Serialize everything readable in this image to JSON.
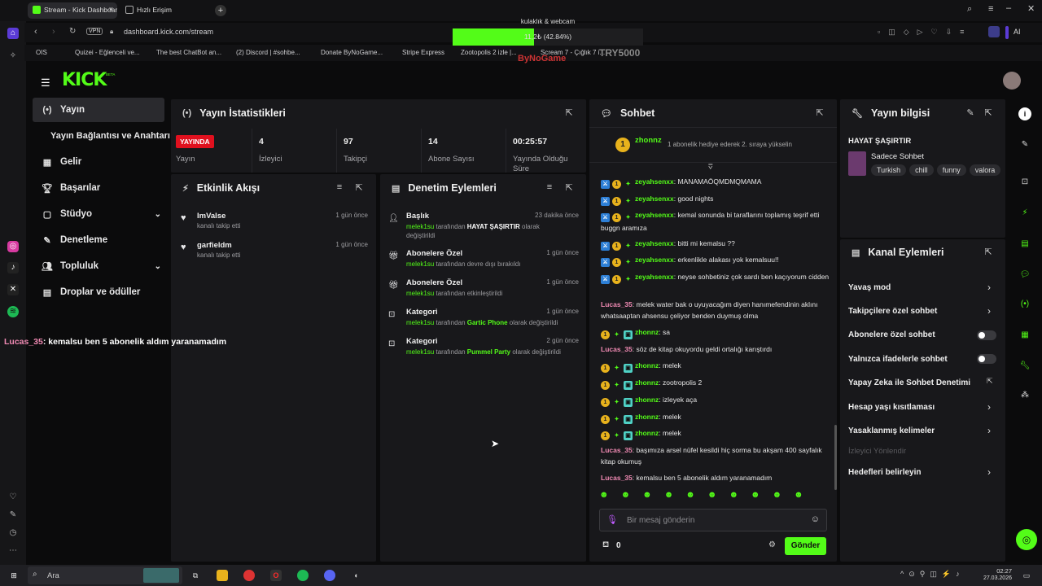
{
  "browser": {
    "tabs": [
      {
        "label": "Stream - Kick Dashboard"
      },
      {
        "label": "Hızlı Erişim"
      }
    ],
    "url": "dashboard.kick.com/stream",
    "vpn": "VPN",
    "ai_label": "AI",
    "bookmarks": [
      "OIS",
      "Quizei - Eğlenceli ve...",
      "The best ChatBot an...",
      "(2) Discord | #sohbe...",
      "Donate ByNoGame...",
      "Stripe Express",
      "Zootopolis 2 izle |...",
      "Scream 7 - Çığlık 7 i..."
    ]
  },
  "overlay": {
    "goal_label": "kulaklık & webcam",
    "goal_text": "11,2₺ (42.84%)",
    "goal_progress": 0.4284,
    "donate_code": "TRY5000",
    "brand": "ByNoGame"
  },
  "kick": {
    "logo": "KICK",
    "logo_beta": "BETA"
  },
  "sidebar": {
    "items": [
      {
        "label": "Yayın"
      },
      {
        "label": "Yayın Bağlantısı ve Anahtarı"
      },
      {
        "label": "Gelir"
      },
      {
        "label": "Başarılar"
      },
      {
        "label": "Stüdyo"
      },
      {
        "label": "Denetleme"
      },
      {
        "label": "Topluluk"
      },
      {
        "label": "Droplar ve ödüller"
      }
    ]
  },
  "overlay_chat": {
    "user": "Lucas_35",
    "message": ": kemalsu ben 5 abonelik aldım yaranamadım"
  },
  "stats": {
    "title": "Yayın İstatistikleri",
    "live_badge": "YAYINDA",
    "live_label": "Yayın",
    "items": [
      {
        "value": "4",
        "label": "İzleyici"
      },
      {
        "value": "97",
        "label": "Takipçi"
      },
      {
        "value": "14",
        "label": "Abone Sayısı"
      },
      {
        "value": "00:25:57",
        "label": "Yayında Olduğu Süre"
      }
    ]
  },
  "activity": {
    "title": "Etkinlik Akışı",
    "items": [
      {
        "name": "ImValse",
        "sub": "kanalı takip etti",
        "time": "1 gün önce"
      },
      {
        "name": "garfieldm",
        "sub": "kanalı takip etti",
        "time": "1 gün önce"
      }
    ]
  },
  "moderation": {
    "title": "Denetim Eylemleri",
    "items": [
      {
        "title": "Başlık",
        "time": "23 dakika önce",
        "user": "melek1su",
        "pre": "tarafından",
        "value": "HAYAT ŞAŞIRTIR",
        "post": "olarak değiştirildi"
      },
      {
        "title": "Abonelere Özel",
        "time": "1 gün önce",
        "user": "melek1su",
        "pre": "tarafından devre dışı bırakıldı",
        "value": "",
        "post": ""
      },
      {
        "title": "Abonelere Özel",
        "time": "1 gün önce",
        "user": "melek1su",
        "pre": "tarafından etkinleştirildi",
        "value": "",
        "post": ""
      },
      {
        "title": "Kategori",
        "time": "1 gün önce",
        "user": "melek1su",
        "pre": "tarafından",
        "value": "Gartic Phone",
        "post": "olarak değiştirildi"
      },
      {
        "title": "Kategori",
        "time": "2 gün önce",
        "user": "melek1su",
        "pre": "tarafından",
        "value": "Pummel Party",
        "post": "olarak değiştirildi"
      }
    ]
  },
  "chat": {
    "title": "Sohbet",
    "pinned_user": "zhonnz",
    "pinned_text": "1 abonelik hediye ederek 2. sıraya yükselin",
    "messages": [
      {
        "user": "zeyahsenxx",
        "text": "MANAMAÖQMDMQMAMA"
      },
      {
        "user": "zeyahsenxx",
        "text": "good nights"
      },
      {
        "user": "zeyahsenxx",
        "text": "kemal sonunda bi taraflarını toplamış teşrif etti buggn aramıza"
      },
      {
        "user": "zeyahsenxx",
        "text": "bitti mi kemalsu ??"
      },
      {
        "user": "zeyahsenxx",
        "text": "erkenlikle alakası yok kemalsuu!!"
      },
      {
        "user": "zeyahsenxx",
        "text": "neyse sohbetiniz çok sardı ben kaçıyorum cidden"
      },
      {
        "user": "Lucas_35",
        "text": "melek water bak o uyuyacağım diyen hanımefendinin aklını whatsaaptan ahsensu çeliyor benden duymuş olma"
      },
      {
        "user": "zhonnz",
        "text": "sa"
      },
      {
        "user": "Lucas_35",
        "text": "söz de kitap okuyordu geldi ortalığı karıştırdı"
      },
      {
        "user": "zhonnz",
        "text": "melek"
      },
      {
        "user": "zhonnz",
        "text": "zootropolis 2"
      },
      {
        "user": "zhonnz",
        "text": "izleyek aça"
      },
      {
        "user": "zhonnz",
        "text": "melek"
      },
      {
        "user": "zhonnz",
        "text": "melek"
      },
      {
        "user": "Lucas_35",
        "text": "başımıza arsel nüfel kesildi hiç sorma bu akşam 400 sayfalık kitap okumuş"
      },
      {
        "user": "Lucas_35",
        "text": "kemalsu ben 5 abonelik aldım yaranamadım"
      }
    ],
    "input_placeholder": "Bir mesaj gönderin",
    "points": "0",
    "send_label": "Gönder"
  },
  "stream_info": {
    "title": "Yayın bilgisi",
    "stream_title": "HAYAT ŞAŞIRTIR",
    "category": "Sadece Sohbet",
    "tags": [
      "Turkish",
      "chill",
      "funny",
      "valora"
    ]
  },
  "channel_actions": {
    "title": "Kanal Eylemleri",
    "items": [
      {
        "label": "Yavaş mod"
      },
      {
        "label": "Takipçilere özel sohbet"
      },
      {
        "label": "Abonelere özel sohbet"
      },
      {
        "label": "Yalnızca ifadelerle sohbet"
      },
      {
        "label": "Yapay Zeka ile Sohbet Denetimi"
      },
      {
        "label": "Hesap yaşı kısıtlaması"
      },
      {
        "label": "Yasaklanmış kelimeler"
      },
      {
        "label": "İzleyici Yönlendir"
      },
      {
        "label": "Hedefleri belirleyin"
      }
    ]
  },
  "taskbar": {
    "search": "Ara",
    "time": "02:27",
    "date": "27.03.2026"
  },
  "colors": {
    "accent": "#53fc18",
    "live": "#e0101e",
    "panel": "#18181b"
  }
}
